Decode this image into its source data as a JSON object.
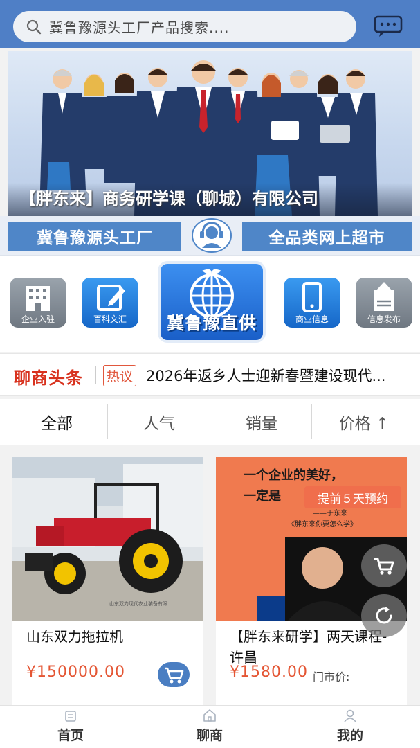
{
  "search": {
    "placeholder": "冀鲁豫源头工厂产品搜索...."
  },
  "banner": {
    "caption": "【胖东来】商务研学课（聊城）有限公司"
  },
  "strip": {
    "left_label": "冀鲁豫源头工厂",
    "right_label": "全品类网上超市"
  },
  "quick_icons": [
    {
      "label": "企业入驻",
      "icon": "building-icon"
    },
    {
      "label": "百科文汇",
      "icon": "edit-icon"
    },
    {
      "label": "冀鲁豫直供",
      "icon": "globe-icon"
    },
    {
      "label": "商业信息",
      "icon": "phone-icon"
    },
    {
      "label": "信息发布",
      "icon": "upload-doc-icon"
    }
  ],
  "news": {
    "title": "聊商头条",
    "tag": "热议",
    "headline": "2026年返乡人士迎新春暨建设现代..."
  },
  "tabs": [
    {
      "label": "全部",
      "active": true
    },
    {
      "label": "人气",
      "active": false
    },
    {
      "label": "销量",
      "active": false
    },
    {
      "label": "价格 ↑",
      "active": false
    }
  ],
  "products": [
    {
      "name": "山东双力拖拉机",
      "price": "¥150000.00",
      "image_caption": "山东双力现代农业装备有限"
    },
    {
      "name": "【胖东来研学】两天课程-许昌",
      "price": "¥1580.00",
      "market_label": "门市价:",
      "image_line1": "一个企业的美好，",
      "image_line2": "一定是",
      "image_quote": "——于东来",
      "image_book": "《胖东来你要怎么学》",
      "promo_tag": "提前５天预约"
    }
  ],
  "bottom_nav": [
    {
      "label": "首页",
      "icon": "home-icon"
    },
    {
      "label": "聊商",
      "icon": "shop-icon"
    },
    {
      "label": "我的",
      "icon": "user-icon"
    }
  ],
  "colors": {
    "header": "#4f7fc6",
    "price": "#e45533",
    "news_title": "#d8321e",
    "cart_button": "#4a7ec2"
  }
}
